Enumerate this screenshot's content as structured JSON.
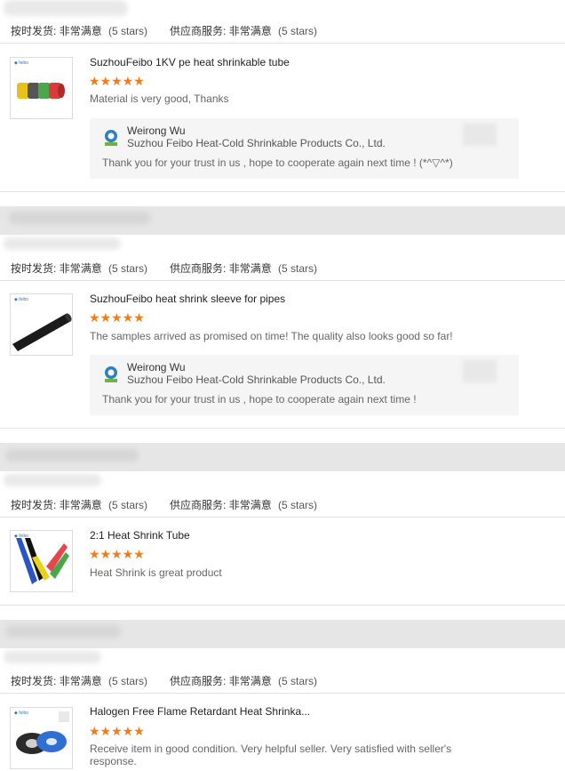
{
  "labels": {
    "on_time_label": "按时发货:",
    "supplier_label": "供应商服务:",
    "value": "非常满意",
    "stars_text": "(5 stars)"
  },
  "reviews": [
    {
      "product": "SuzhouFeibo 1KV pe heat shrinkable tube",
      "stars": "★★★★★",
      "comment": "Material is very good, Thanks",
      "reply": {
        "name": "Weirong Wu",
        "company": "Suzhou Feibo Heat-Cold Shrinkable Products Co., Ltd.",
        "text": "Thank you for your trust in us ,   hope to cooperate again next time ! (*^▽^*)"
      }
    },
    {
      "product": "SuzhouFeibo heat shrink sleeve for pipes",
      "stars": "★★★★★",
      "comment": "The samples arrived as promised on time! The quality also looks good so far!",
      "reply": {
        "name": "Weirong Wu",
        "company": "Suzhou Feibo Heat-Cold Shrinkable Products Co., Ltd.",
        "text": "Thank you for your trust in us ,   hope to cooperate again next time !"
      }
    },
    {
      "product": "2:1 Heat Shrink Tube",
      "stars": "★★★★★",
      "comment": "Heat Shrink is great product"
    },
    {
      "product": "Halogen Free Flame Retardant Heat Shrinka...",
      "stars": "★★★★★",
      "comment": "Receive item in good condition. Very helpful seller. Very satisfied with seller's response."
    }
  ],
  "colors": {
    "star": "#f07c1a",
    "reply_bg": "#f5f5f5",
    "band": "#e6e6e6"
  }
}
